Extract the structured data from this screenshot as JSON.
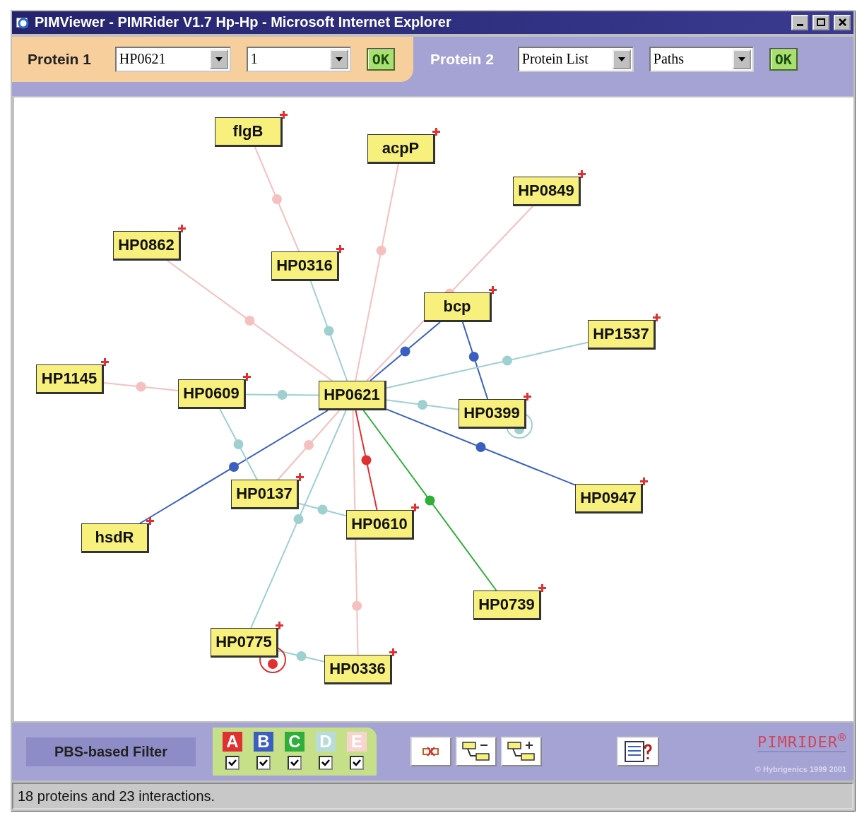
{
  "window": {
    "title": "PIMViewer - PIMRider V1.7 Hp-Hp - Microsoft Internet Explorer"
  },
  "protein_1": {
    "label": "Protein 1",
    "protein": "HP0621",
    "depth": "1",
    "button": "OK"
  },
  "protein_2": {
    "label": "Protein 2",
    "list": "Protein List",
    "mode": "Paths",
    "button": "OK"
  },
  "proteins": [
    {
      "name": "flgB",
      "expandable": true
    },
    {
      "name": "acpP",
      "expandable": true
    },
    {
      "name": "HP0849",
      "expandable": true
    },
    {
      "name": "HP0862",
      "expandable": true
    },
    {
      "name": "HP0316",
      "expandable": true
    },
    {
      "name": "bcp",
      "expandable": true
    },
    {
      "name": "HP1537",
      "expandable": true
    },
    {
      "name": "HP1145",
      "expandable": true
    },
    {
      "name": "HP0609",
      "expandable": true
    },
    {
      "name": "HP0621",
      "expandable": false
    },
    {
      "name": "HP0399",
      "expandable": true
    },
    {
      "name": "HP0137",
      "expandable": true
    },
    {
      "name": "HP0947",
      "expandable": true
    },
    {
      "name": "hsdR",
      "expandable": true
    },
    {
      "name": "HP0610",
      "expandable": true
    },
    {
      "name": "HP0739",
      "expandable": true
    },
    {
      "name": "HP0775",
      "expandable": true
    },
    {
      "name": "HP0336",
      "expandable": true
    }
  ],
  "interactions": [
    {
      "color": "#f5c0c0"
    },
    {
      "color": "#9fd0d0"
    },
    {
      "color": "#f5c0c0"
    },
    {
      "color": "#f5c0c0"
    },
    {
      "color": "#f5c0c0"
    },
    {
      "color": "#3a5fc0"
    },
    {
      "color": "#3a5fc0"
    },
    {
      "color": "#9fd0d0"
    },
    {
      "color": "#f5c0c0"
    },
    {
      "color": "#9fd0d0"
    },
    {
      "color": "#9fd0d0"
    },
    {
      "color": "#9fd0d0"
    },
    {
      "color": "#3a5fc0"
    },
    {
      "color": "#3a5fc0"
    },
    {
      "color": "#9fd0d0"
    },
    {
      "color": "#f5c0c0"
    },
    {
      "color": "#e03030"
    },
    {
      "color": "#2fae3a"
    },
    {
      "color": "#9fd0d0"
    },
    {
      "color": "#9fd0d0"
    },
    {
      "color": "#f5c0c0"
    },
    {
      "color": "#9fd0d0"
    },
    {
      "color": "#e03030"
    }
  ],
  "filter": {
    "label": "PBS-based Filter",
    "categories": [
      {
        "letter": "A",
        "color": "#e03030",
        "checked": true
      },
      {
        "letter": "B",
        "color": "#3a5fc0",
        "checked": true
      },
      {
        "letter": "C",
        "color": "#2fae3a",
        "checked": true
      },
      {
        "letter": "D",
        "color": "#b8dcdc",
        "checked": true
      },
      {
        "letter": "E",
        "color": "#f8d4d0",
        "checked": true
      }
    ]
  },
  "logo": {
    "text": "PIMRIDER$^{®}$",
    "copyright": "© Hybrigenics 1999 2001"
  },
  "status_bar": "18 proteins and 23 interactions."
}
